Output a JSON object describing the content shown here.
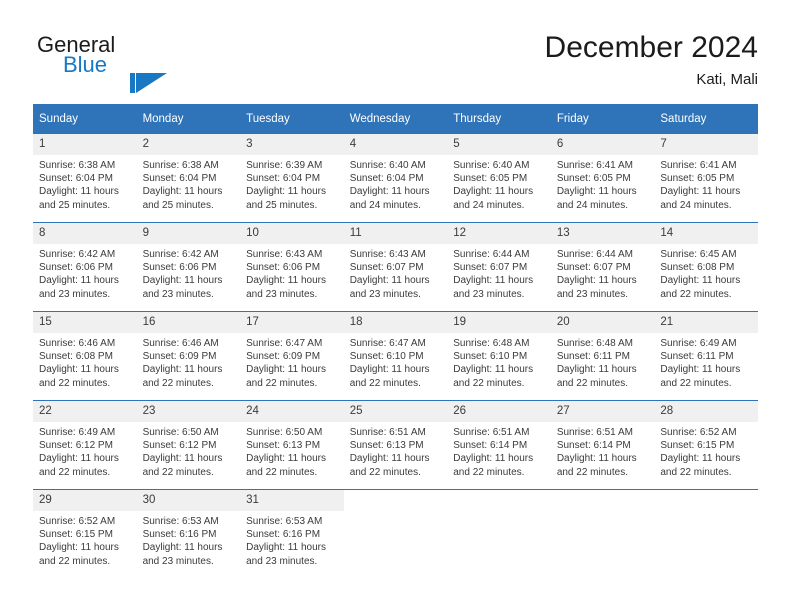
{
  "brand": {
    "name_top": "General",
    "name_bottom": "Blue",
    "accent_color": "#1878c4"
  },
  "header": {
    "title": "December 2024",
    "subtitle": "Kati, Mali"
  },
  "theme": {
    "header_blue": "#2f73b8",
    "daynum_bg": "#f0f0f0",
    "text": "#3b3b3b"
  },
  "calendar": {
    "day_headers": [
      "Sunday",
      "Monday",
      "Tuesday",
      "Wednesday",
      "Thursday",
      "Friday",
      "Saturday"
    ],
    "weeks": [
      [
        {
          "day": "1",
          "sunrise": "Sunrise: 6:38 AM",
          "sunset": "Sunset: 6:04 PM",
          "daylight1": "Daylight: 11 hours",
          "daylight2": "and 25 minutes."
        },
        {
          "day": "2",
          "sunrise": "Sunrise: 6:38 AM",
          "sunset": "Sunset: 6:04 PM",
          "daylight1": "Daylight: 11 hours",
          "daylight2": "and 25 minutes."
        },
        {
          "day": "3",
          "sunrise": "Sunrise: 6:39 AM",
          "sunset": "Sunset: 6:04 PM",
          "daylight1": "Daylight: 11 hours",
          "daylight2": "and 25 minutes."
        },
        {
          "day": "4",
          "sunrise": "Sunrise: 6:40 AM",
          "sunset": "Sunset: 6:04 PM",
          "daylight1": "Daylight: 11 hours",
          "daylight2": "and 24 minutes."
        },
        {
          "day": "5",
          "sunrise": "Sunrise: 6:40 AM",
          "sunset": "Sunset: 6:05 PM",
          "daylight1": "Daylight: 11 hours",
          "daylight2": "and 24 minutes."
        },
        {
          "day": "6",
          "sunrise": "Sunrise: 6:41 AM",
          "sunset": "Sunset: 6:05 PM",
          "daylight1": "Daylight: 11 hours",
          "daylight2": "and 24 minutes."
        },
        {
          "day": "7",
          "sunrise": "Sunrise: 6:41 AM",
          "sunset": "Sunset: 6:05 PM",
          "daylight1": "Daylight: 11 hours",
          "daylight2": "and 24 minutes."
        }
      ],
      [
        {
          "day": "8",
          "sunrise": "Sunrise: 6:42 AM",
          "sunset": "Sunset: 6:06 PM",
          "daylight1": "Daylight: 11 hours",
          "daylight2": "and 23 minutes."
        },
        {
          "day": "9",
          "sunrise": "Sunrise: 6:42 AM",
          "sunset": "Sunset: 6:06 PM",
          "daylight1": "Daylight: 11 hours",
          "daylight2": "and 23 minutes."
        },
        {
          "day": "10",
          "sunrise": "Sunrise: 6:43 AM",
          "sunset": "Sunset: 6:06 PM",
          "daylight1": "Daylight: 11 hours",
          "daylight2": "and 23 minutes."
        },
        {
          "day": "11",
          "sunrise": "Sunrise: 6:43 AM",
          "sunset": "Sunset: 6:07 PM",
          "daylight1": "Daylight: 11 hours",
          "daylight2": "and 23 minutes."
        },
        {
          "day": "12",
          "sunrise": "Sunrise: 6:44 AM",
          "sunset": "Sunset: 6:07 PM",
          "daylight1": "Daylight: 11 hours",
          "daylight2": "and 23 minutes."
        },
        {
          "day": "13",
          "sunrise": "Sunrise: 6:44 AM",
          "sunset": "Sunset: 6:07 PM",
          "daylight1": "Daylight: 11 hours",
          "daylight2": "and 23 minutes."
        },
        {
          "day": "14",
          "sunrise": "Sunrise: 6:45 AM",
          "sunset": "Sunset: 6:08 PM",
          "daylight1": "Daylight: 11 hours",
          "daylight2": "and 22 minutes."
        }
      ],
      [
        {
          "day": "15",
          "sunrise": "Sunrise: 6:46 AM",
          "sunset": "Sunset: 6:08 PM",
          "daylight1": "Daylight: 11 hours",
          "daylight2": "and 22 minutes."
        },
        {
          "day": "16",
          "sunrise": "Sunrise: 6:46 AM",
          "sunset": "Sunset: 6:09 PM",
          "daylight1": "Daylight: 11 hours",
          "daylight2": "and 22 minutes."
        },
        {
          "day": "17",
          "sunrise": "Sunrise: 6:47 AM",
          "sunset": "Sunset: 6:09 PM",
          "daylight1": "Daylight: 11 hours",
          "daylight2": "and 22 minutes."
        },
        {
          "day": "18",
          "sunrise": "Sunrise: 6:47 AM",
          "sunset": "Sunset: 6:10 PM",
          "daylight1": "Daylight: 11 hours",
          "daylight2": "and 22 minutes."
        },
        {
          "day": "19",
          "sunrise": "Sunrise: 6:48 AM",
          "sunset": "Sunset: 6:10 PM",
          "daylight1": "Daylight: 11 hours",
          "daylight2": "and 22 minutes."
        },
        {
          "day": "20",
          "sunrise": "Sunrise: 6:48 AM",
          "sunset": "Sunset: 6:11 PM",
          "daylight1": "Daylight: 11 hours",
          "daylight2": "and 22 minutes."
        },
        {
          "day": "21",
          "sunrise": "Sunrise: 6:49 AM",
          "sunset": "Sunset: 6:11 PM",
          "daylight1": "Daylight: 11 hours",
          "daylight2": "and 22 minutes."
        }
      ],
      [
        {
          "day": "22",
          "sunrise": "Sunrise: 6:49 AM",
          "sunset": "Sunset: 6:12 PM",
          "daylight1": "Daylight: 11 hours",
          "daylight2": "and 22 minutes."
        },
        {
          "day": "23",
          "sunrise": "Sunrise: 6:50 AM",
          "sunset": "Sunset: 6:12 PM",
          "daylight1": "Daylight: 11 hours",
          "daylight2": "and 22 minutes."
        },
        {
          "day": "24",
          "sunrise": "Sunrise: 6:50 AM",
          "sunset": "Sunset: 6:13 PM",
          "daylight1": "Daylight: 11 hours",
          "daylight2": "and 22 minutes."
        },
        {
          "day": "25",
          "sunrise": "Sunrise: 6:51 AM",
          "sunset": "Sunset: 6:13 PM",
          "daylight1": "Daylight: 11 hours",
          "daylight2": "and 22 minutes."
        },
        {
          "day": "26",
          "sunrise": "Sunrise: 6:51 AM",
          "sunset": "Sunset: 6:14 PM",
          "daylight1": "Daylight: 11 hours",
          "daylight2": "and 22 minutes."
        },
        {
          "day": "27",
          "sunrise": "Sunrise: 6:51 AM",
          "sunset": "Sunset: 6:14 PM",
          "daylight1": "Daylight: 11 hours",
          "daylight2": "and 22 minutes."
        },
        {
          "day": "28",
          "sunrise": "Sunrise: 6:52 AM",
          "sunset": "Sunset: 6:15 PM",
          "daylight1": "Daylight: 11 hours",
          "daylight2": "and 22 minutes."
        }
      ],
      [
        {
          "day": "29",
          "sunrise": "Sunrise: 6:52 AM",
          "sunset": "Sunset: 6:15 PM",
          "daylight1": "Daylight: 11 hours",
          "daylight2": "and 22 minutes."
        },
        {
          "day": "30",
          "sunrise": "Sunrise: 6:53 AM",
          "sunset": "Sunset: 6:16 PM",
          "daylight1": "Daylight: 11 hours",
          "daylight2": "and 23 minutes."
        },
        {
          "day": "31",
          "sunrise": "Sunrise: 6:53 AM",
          "sunset": "Sunset: 6:16 PM",
          "daylight1": "Daylight: 11 hours",
          "daylight2": "and 23 minutes."
        },
        {
          "day": "",
          "sunrise": "",
          "sunset": "",
          "daylight1": "",
          "daylight2": ""
        },
        {
          "day": "",
          "sunrise": "",
          "sunset": "",
          "daylight1": "",
          "daylight2": ""
        },
        {
          "day": "",
          "sunrise": "",
          "sunset": "",
          "daylight1": "",
          "daylight2": ""
        },
        {
          "day": "",
          "sunrise": "",
          "sunset": "",
          "daylight1": "",
          "daylight2": ""
        }
      ]
    ]
  }
}
